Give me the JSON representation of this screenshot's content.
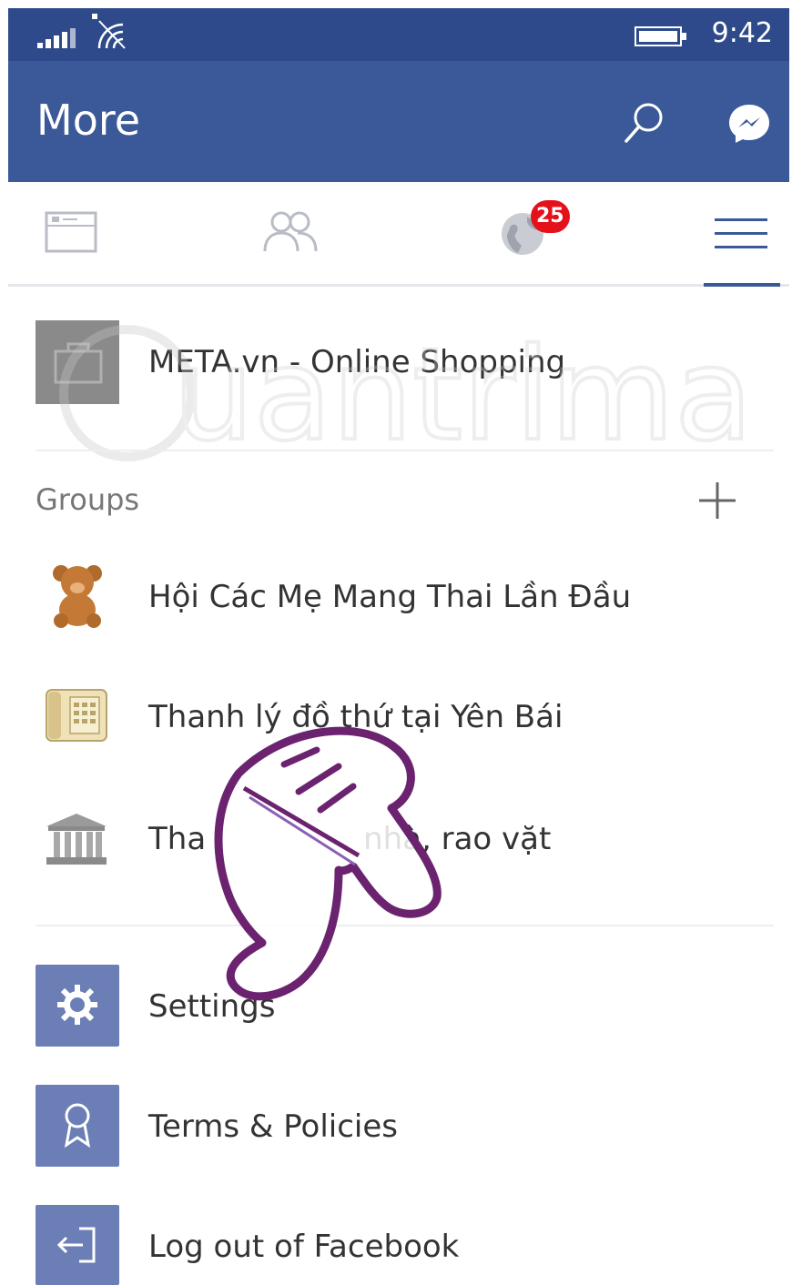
{
  "status_bar": {
    "time": "9:42"
  },
  "app_bar": {
    "title": "More"
  },
  "tabs": {
    "notifications_badge": "25"
  },
  "pages": [
    {
      "label": "META.vn - Online Shopping"
    }
  ],
  "groups": {
    "header": "Groups",
    "items": [
      {
        "label": "Hội Các Mẹ Mang Thai Lần Đầu",
        "icon": "teddy-bear-icon"
      },
      {
        "label": "Thanh lý đồ thứ tại Yên Bái",
        "icon": "phone-icon"
      },
      {
        "label": "Tha                nhà, rao vặt",
        "icon": "bank-building-icon"
      }
    ]
  },
  "menu": [
    {
      "label": "Settings",
      "icon": "gear-icon"
    },
    {
      "label": "Terms & Policies",
      "icon": "ribbon-icon"
    },
    {
      "label": "Log out of Facebook",
      "icon": "logout-icon"
    }
  ],
  "colors": {
    "status_bar": "#2e4a8b",
    "app_bar": "#3b5998",
    "badge": "#e4101a",
    "menu_icon_bg": "#6b7fb6"
  }
}
